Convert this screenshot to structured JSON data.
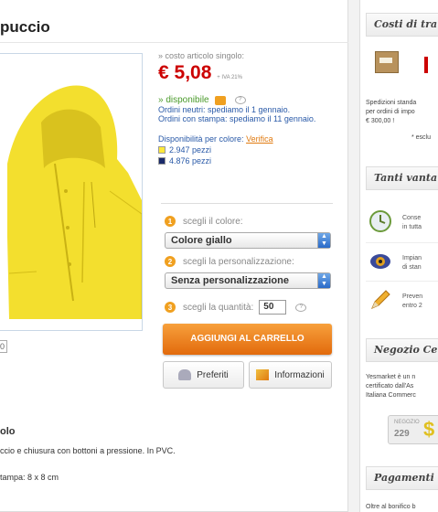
{
  "product": {
    "title": "puccio",
    "thumb_label": "0"
  },
  "pricing": {
    "cost_label": "» costo articolo singolo:",
    "price": "€ 5,08",
    "iva_label": "+ IVA 21%"
  },
  "availability": {
    "status": "» disponibile",
    "line1": "Ordini neutri: spediamo il 1 gennaio.",
    "line2": "Ordini con stampa: spediamo il 11 gennaio.",
    "color_label": "Disponibilità per colore:",
    "verify_link": "Verifica",
    "stock": [
      {
        "qty": "2.947 pezzi",
        "color": "#ffe83a"
      },
      {
        "qty": "4.876 pezzi",
        "color": "#1a2a6a"
      }
    ]
  },
  "options": {
    "step1": {
      "num": "1",
      "label": "scegli il colore:"
    },
    "color_select": "Colore giallo",
    "step2": {
      "num": "2",
      "label": "scegli la personalizzazione:"
    },
    "custom_select": "Senza personalizzazione",
    "step3": {
      "num": "3",
      "label": "scegli la quantità:"
    },
    "quantity": "50"
  },
  "actions": {
    "add_to_cart": "AGGIUNGI AL CARRELLO",
    "favorites": "Preferiti",
    "info": "Informazioni"
  },
  "description": {
    "title": "olo",
    "text": "ccio e chiusura con bottoni a pressione. In PVC.",
    "print_area": "tampa: 8 x 8 cm"
  },
  "sidebar": {
    "shipping_title": "Costi di tra",
    "shipping_line1": "Spedizioni standa",
    "shipping_line2": "per ordini di impo",
    "shipping_line3": "€ 300,00 !",
    "shipping_note": "* esclu",
    "advantages_title": "Tanti vanta",
    "advantages": [
      {
        "line1": "Conse",
        "line2": "in tutta"
      },
      {
        "line1": "Impian",
        "line2": "di stan"
      },
      {
        "line1": "Preven",
        "line2": "entro 2"
      }
    ],
    "store_title": "Negozio Ce",
    "store_line1": "Yesmarket è un n",
    "store_line2": "certificato dall'As",
    "store_line3": "Italiana Commerc",
    "store_badge_label": "NEGOZIO",
    "store_badge_num": "229",
    "payments_title": "Pagamenti",
    "payments_line": "Oltre al bonifico b"
  },
  "colors": {
    "accent_orange": "#f08a1c",
    "price_red": "#cc0000",
    "stock_yellow": "#ffe83a",
    "stock_navy": "#1a2a6a"
  }
}
